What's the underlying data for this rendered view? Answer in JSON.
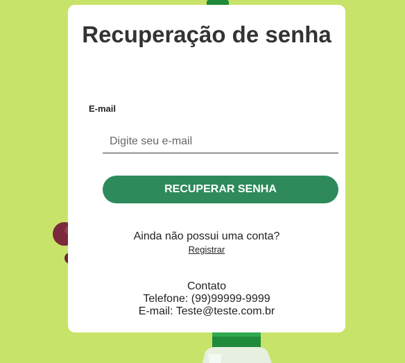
{
  "page": {
    "background_color": "#c8e36a",
    "accent_color": "#2e8a5a"
  },
  "card": {
    "title": "Recuperação de senha",
    "email_label": "E-mail",
    "email_placeholder": "Digite seu e-mail",
    "email_value": "",
    "recover_button_label": "RECUPERAR SENHA",
    "no_account_text": "Ainda não possui uma conta?",
    "register_link_label": "Registrar"
  },
  "contact": {
    "heading": "Contato",
    "phone": "Telefone: (99)99999-9999",
    "email": "E-mail: Teste@teste.com.br"
  }
}
